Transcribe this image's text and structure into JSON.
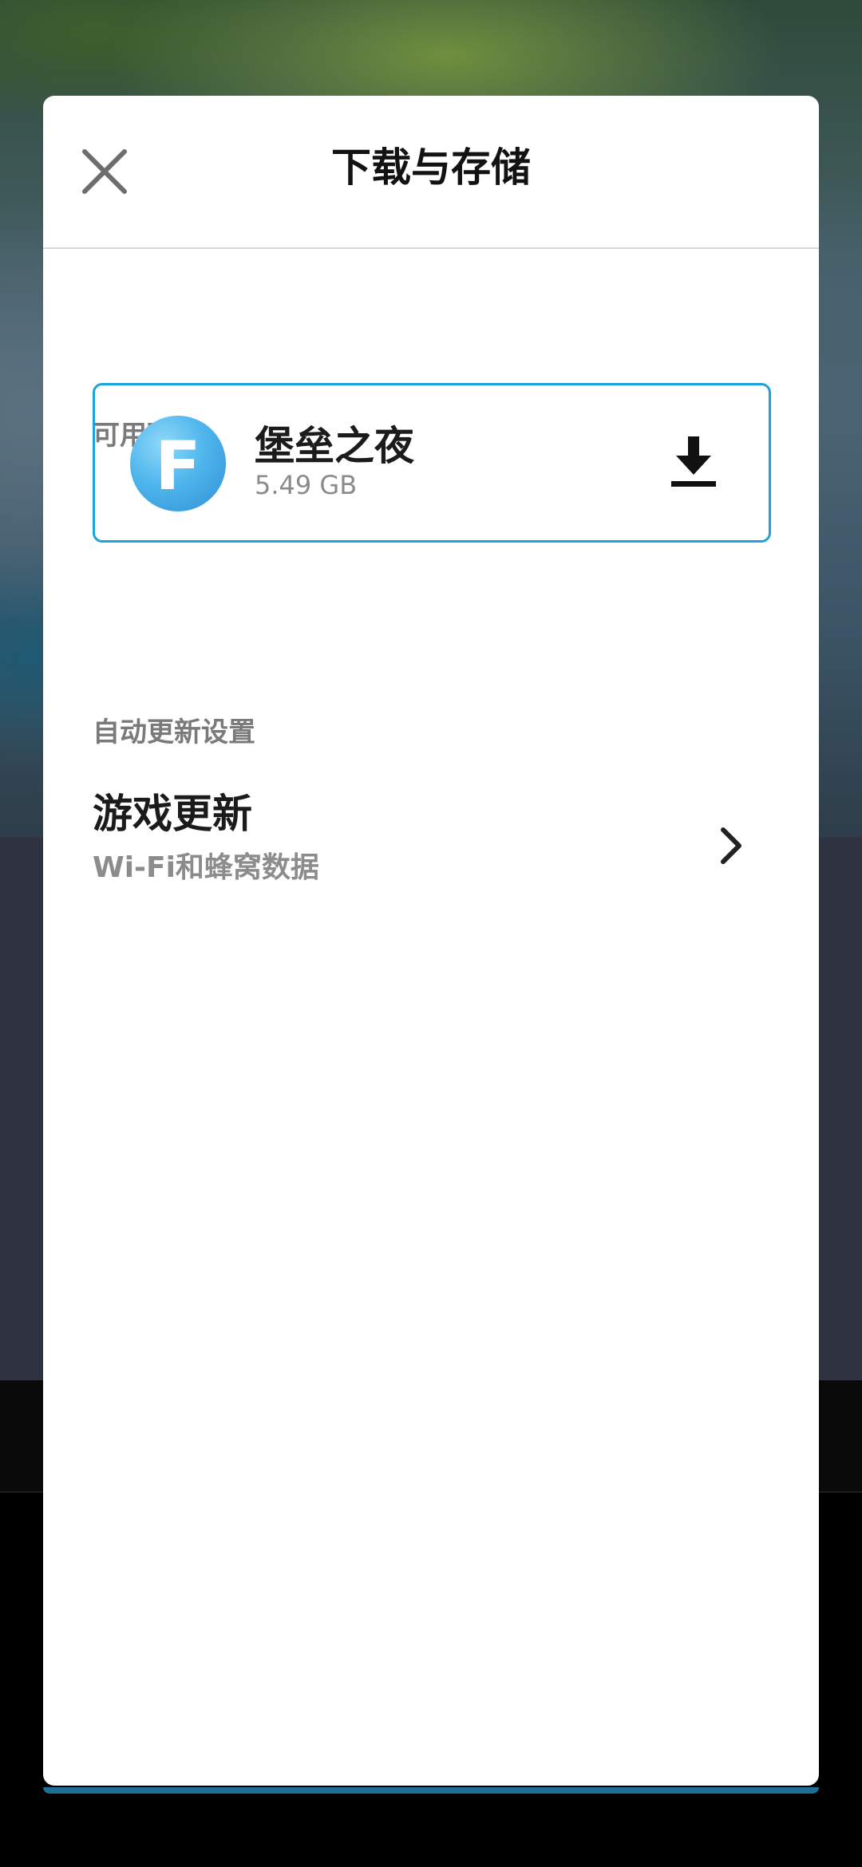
{
  "header": {
    "title": "下载与存储",
    "close_icon": "close-icon"
  },
  "downloads_section": {
    "label": "可用下载",
    "items": [
      {
        "name": "堡垒之夜",
        "size": "5.49 GB",
        "logo_letter": "F",
        "logo_color": "#4fb6ec",
        "action_icon": "download-icon"
      }
    ]
  },
  "auto_update_section": {
    "label": "自动更新设置",
    "rows": [
      {
        "title": "游戏更新",
        "value": "Wi-Fi和蜂窝数据",
        "icon": "chevron-right-icon"
      }
    ]
  },
  "colors": {
    "accent": "#1aa3dc",
    "sheet_background": "#ffffff",
    "primary_text": "#1b1b1b",
    "secondary_text": "#8c8c8c"
  }
}
